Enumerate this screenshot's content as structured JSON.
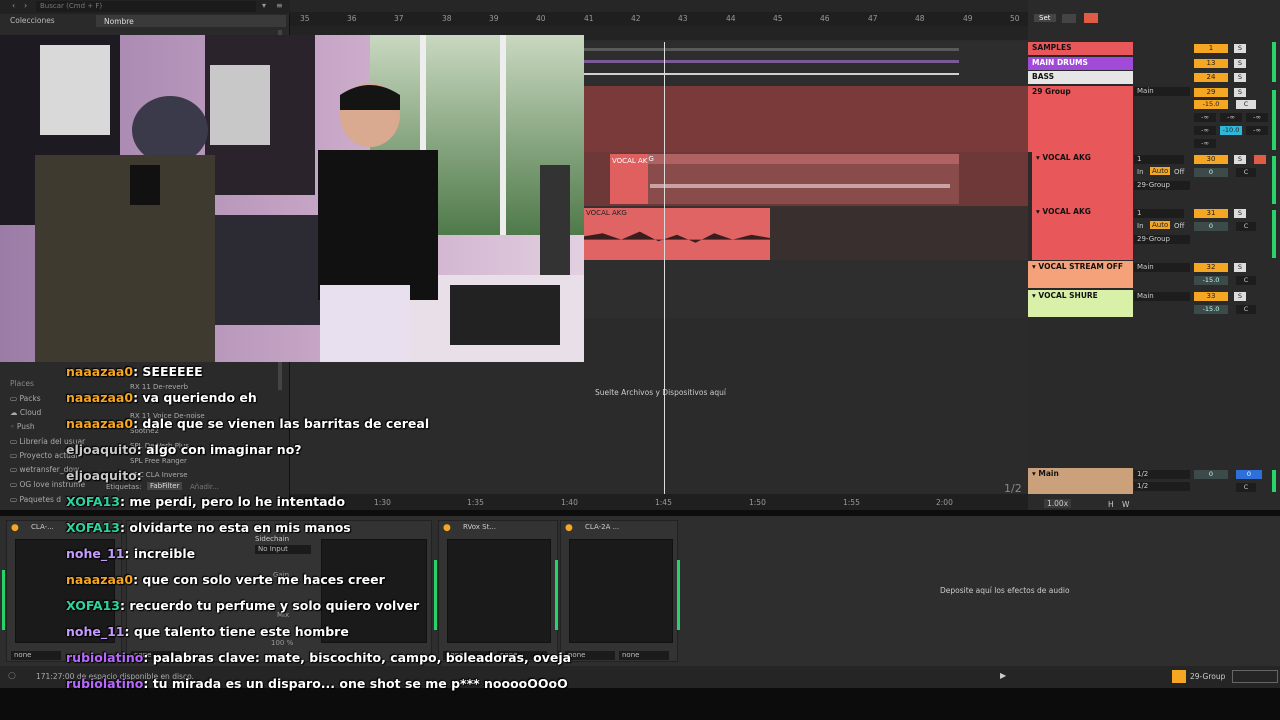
{
  "browser": {
    "search_placeholder": "Buscar (Cmd + F)",
    "collections_header": "Colecciones",
    "name_header": "Nombre",
    "places_header": "Places",
    "places": [
      "Packs",
      "Cloud",
      "Push",
      "Librería del usuar",
      "Proyecto actual",
      "wetransfer_dow",
      "OG love instrume",
      "Paquetes d"
    ],
    "list_items": [
      "RX 11 De-reverb",
      "RX 11 Voice De-noise",
      "Soothe2",
      "SPL De-Verb Plus",
      "SPL Free Ranger",
      "TEC CLA Inverse"
    ],
    "tags_label": "Etiquetas:",
    "tag_value": "FabFilter",
    "tag_add": "Añadir..."
  },
  "arrangement": {
    "ruler_bars": [
      "35",
      "36",
      "37",
      "38",
      "39",
      "40",
      "41",
      "42",
      "43",
      "44",
      "45",
      "46",
      "47",
      "48",
      "49",
      "50"
    ],
    "time_labels": [
      "1:30",
      "1:35",
      "1:40",
      "1:45",
      "1:50",
      "1:55",
      "2:00"
    ],
    "clips": [
      {
        "label": "VOCAL AKG",
        "sublabel": "VOCAL AK"
      },
      {
        "label": "VOCAL AKG"
      }
    ],
    "drop_hint": "Suelte Archivos y Dispositivos aquí",
    "page_indicator": "1/2",
    "set_label": "Set"
  },
  "tracks": [
    {
      "name": "SAMPLES",
      "color": "#e8585a",
      "num": "1",
      "solo": "S"
    },
    {
      "name": "MAIN DRUMS",
      "color": "#a14ad9",
      "num": "13",
      "solo": "S"
    },
    {
      "name": "BASS",
      "color": "#e6e6e6",
      "num": "24",
      "solo": "S"
    },
    {
      "name": "29 Group",
      "color": "#e8585a",
      "num": "29",
      "solo": "S",
      "route": "Main",
      "vol": "-15.0",
      "pan": "C",
      "sends": [
        "-∞",
        "-∞",
        "-∞",
        "-∞",
        "-∞",
        "-10.0",
        "-∞"
      ]
    },
    {
      "name": "VOCAL AKG",
      "color": "#e8585a",
      "num": "30",
      "solo": "S",
      "input": "1",
      "monitor_in": "In",
      "monitor_auto": "Auto",
      "monitor_off": "Off",
      "route": "29-Group",
      "vol": "0",
      "pan": "C"
    },
    {
      "name": "VOCAL AKG",
      "color": "#e8585a",
      "num": "31",
      "solo": "S",
      "input": "1",
      "monitor_in": "In",
      "monitor_auto": "Auto",
      "monitor_off": "Off",
      "route": "29-Group",
      "vol": "0",
      "pan": "C"
    },
    {
      "name": "VOCAL STREAM OFF",
      "color": "#f5a27a",
      "num": "32",
      "solo": "S",
      "route": "Main",
      "vol": "-15.0",
      "pan": "C"
    },
    {
      "name": "VOCAL SHURE",
      "color": "#d8f0a8",
      "num": "33",
      "solo": "S",
      "route": "Main",
      "vol": "-15.0",
      "pan": "C"
    },
    {
      "name": "Main",
      "color": "#caa17a",
      "route_a": "1/2",
      "route_b": "1/2",
      "vol": "0",
      "vol2": "0",
      "pan": "C"
    }
  ],
  "master": {
    "tempo_ratio": "1.00x",
    "h": "H",
    "w": "W"
  },
  "devices": {
    "items": [
      {
        "title": "CLA-..."
      },
      {
        "title": "Sidechain",
        "input": "No Input",
        "gain_label": "Gain",
        "mix_label": "Mix",
        "mix_value": "100 %"
      },
      {
        "title": "RVox St..."
      },
      {
        "title": "CLA-2A ..."
      }
    ],
    "none_label": "none",
    "drop_hint": "Deposite aquí los efectos de audio"
  },
  "status": {
    "disk_text": "171:27:00 de espacio disponible en disco.",
    "group_label": "29-Group"
  },
  "chat": [
    {
      "user": "naaazaa0",
      "text": ": SEEEEEE",
      "cls": "u-naa"
    },
    {
      "user": "naaazaa0",
      "text": ": va queriendo eh",
      "cls": "u-naa"
    },
    {
      "user": "naaazaa0",
      "text": ": dale que se vienen las barritas de cereal",
      "cls": "u-naa"
    },
    {
      "user": "eljoaquito",
      "text": ": algo con imaginar no?",
      "cls": "u-elj"
    },
    {
      "user": "eljoaquito",
      "text": ":",
      "cls": "u-elj"
    },
    {
      "user": "XOFA13",
      "text": ": me perdi, pero lo he intentado",
      "cls": "u-xofa"
    },
    {
      "user": "XOFA13",
      "text": ": olvidarte no esta en mis manos",
      "cls": "u-xofa"
    },
    {
      "user": "nohe_11",
      "text": ": increible",
      "cls": "u-nohe"
    },
    {
      "user": "naaazaa0",
      "text": ": que con solo verte me haces creer",
      "cls": "u-naa"
    },
    {
      "user": "XOFA13",
      "text": ": recuerdo tu perfume y solo quiero volver",
      "cls": "u-xofa"
    },
    {
      "user": "nohe_11",
      "text": ": que talento tiene este hombre",
      "cls": "u-nohe"
    },
    {
      "user": "rubiolatino",
      "text": ": palabras clave: mate, biscochito, campo, boleadoras, oveja",
      "cls": "u-rubio"
    },
    {
      "user": "rubiolatino",
      "text": ": tu mirada es un disparo... one shot se me p*** nooooOOoO",
      "cls": "u-rubio"
    }
  ]
}
